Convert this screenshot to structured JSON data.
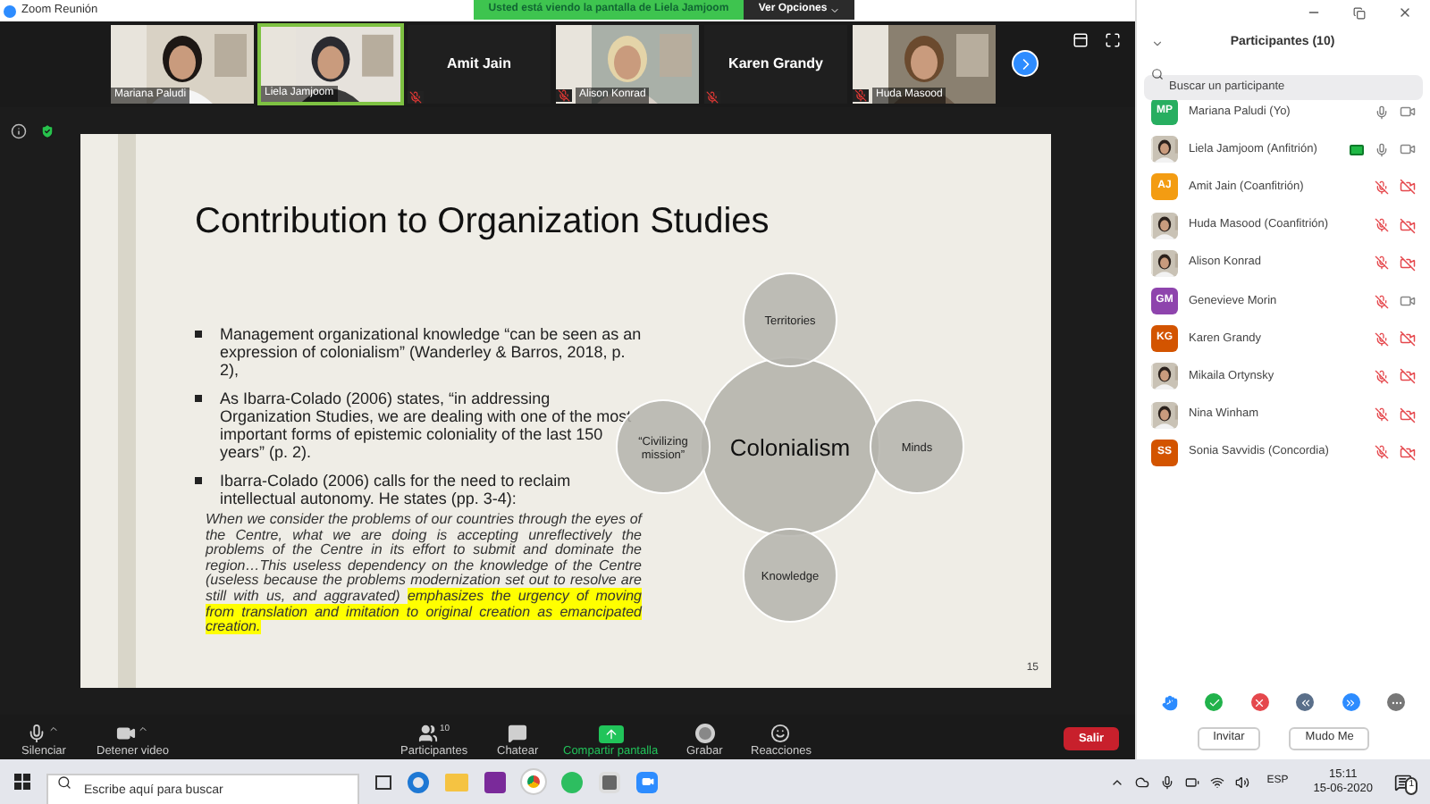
{
  "window": {
    "title": "Zoom Reunión"
  },
  "share_banner": {
    "text": "Usted está viendo la pantalla de Liela Jamjoom",
    "options": "Ver Opciones"
  },
  "video_tiles": [
    {
      "name": "Mariana Paludi",
      "kind": "video",
      "muted": false,
      "speaking": false
    },
    {
      "name": "Liela Jamjoom",
      "kind": "video",
      "muted": false,
      "speaking": true
    },
    {
      "name": "Amit Jain",
      "kind": "name",
      "muted": true,
      "speaking": false
    },
    {
      "name": "Alison Konrad",
      "kind": "video",
      "muted": true,
      "speaking": false
    },
    {
      "name": "Karen Grandy",
      "kind": "name",
      "muted": true,
      "speaking": false
    },
    {
      "name": "Huda Masood",
      "kind": "video",
      "muted": true,
      "speaking": false
    }
  ],
  "slide": {
    "title": "Contribution to Organization Studies",
    "bullets": [
      "Management organizational knowledge  “can be seen as an expression of colonialism” (Wanderley & Barros, 2018, p. 2),",
      "As Ibarra-Colado (2006) states, “in addressing Organization Studies, we are dealing with one of the most important forms of epistemic coloniality of the last 150 years” (p. 2).",
      "Ibarra-Colado (2006) calls for the need to reclaim intellectual autonomy. He states (pp. 3-4):"
    ],
    "quote": "When we consider the problems of our countries through the eyes of the Centre, what we are doing is accepting unreflectively the problems of the Centre in its effort to submit and dominate the region…This useless dependency on the knowledge of the Centre (useless because the problems modernization set out to resolve are still with us, and aggravated)",
    "quote_highlight": "emphasizes the urgency of moving from translation and imitation to original creation as emancipated creation.",
    "diagram": {
      "center": "Colonialism",
      "nodes": [
        {
          "label": "Territories"
        },
        {
          "label": "Minds"
        },
        {
          "label": "Knowledge"
        },
        {
          "label": "“Civilizing mission”"
        }
      ]
    },
    "page_number": "15"
  },
  "toolbar": [
    {
      "label": "Silenciar",
      "kind": "mic",
      "caret": true
    },
    {
      "label": "Detener video",
      "kind": "video",
      "caret": true
    },
    {
      "label": "Participantes",
      "kind": "participants",
      "count": "10"
    },
    {
      "label": "Chatear",
      "kind": "chat"
    },
    {
      "label": "Compartir pantalla",
      "kind": "share"
    },
    {
      "label": "Grabar",
      "kind": "record"
    },
    {
      "label": "Reacciones",
      "kind": "reactions"
    }
  ],
  "leave_button": "Salir",
  "participants_panel": {
    "title": "Participantes (10)",
    "search": {
      "placeholder": "Buscar un participante"
    },
    "participants": [
      {
        "name": "Mariana Paludi (Yo)",
        "avatar": {
          "kind": "initials",
          "text": "MP",
          "color": "#27ae60"
        },
        "sharing": false,
        "mic_muted": false,
        "video_off": false
      },
      {
        "name": "Liela Jamjoom (Anfitrión)",
        "sharing": true,
        "mic_muted": false,
        "video_off": false
      },
      {
        "name": "Amit Jain (Coanfitrión)",
        "avatar": {
          "kind": "initials",
          "text": "AJ",
          "color": "#f39c12"
        },
        "sharing": false,
        "mic_muted": true,
        "video_off": true
      },
      {
        "name": "Huda Masood (Coanfitrión)",
        "sharing": false,
        "mic_muted": true,
        "video_off": true
      },
      {
        "name": "Alison Konrad",
        "sharing": false,
        "mic_muted": true,
        "video_off": true
      },
      {
        "name": "Genevieve Morin",
        "avatar": {
          "kind": "initials",
          "text": "GM",
          "color": "#8e44ad"
        },
        "sharing": false,
        "mic_muted": true,
        "video_off": false
      },
      {
        "name": "Karen Grandy",
        "avatar": {
          "kind": "initials",
          "text": "KG",
          "color": "#d35400"
        },
        "sharing": false,
        "mic_muted": true,
        "video_off": true
      },
      {
        "name": "Mikaila Ortynsky",
        "sharing": false,
        "mic_muted": true,
        "video_off": true
      },
      {
        "name": "Nina Winham",
        "sharing": false,
        "mic_muted": true,
        "video_off": true
      },
      {
        "name": "Sonia Savvidis (Concordia)",
        "avatar": {
          "kind": "initials",
          "text": "SS",
          "color": "#d35400"
        },
        "sharing": false,
        "mic_muted": true,
        "video_off": true
      }
    ],
    "buttons": [
      "Invitar",
      "Mudo Me"
    ]
  },
  "taskbar": {
    "search": {
      "placeholder": "Escribe aquí para buscar"
    },
    "language": "ESP",
    "time": "15:11",
    "date": "15-06-2020",
    "notifications": "1"
  }
}
